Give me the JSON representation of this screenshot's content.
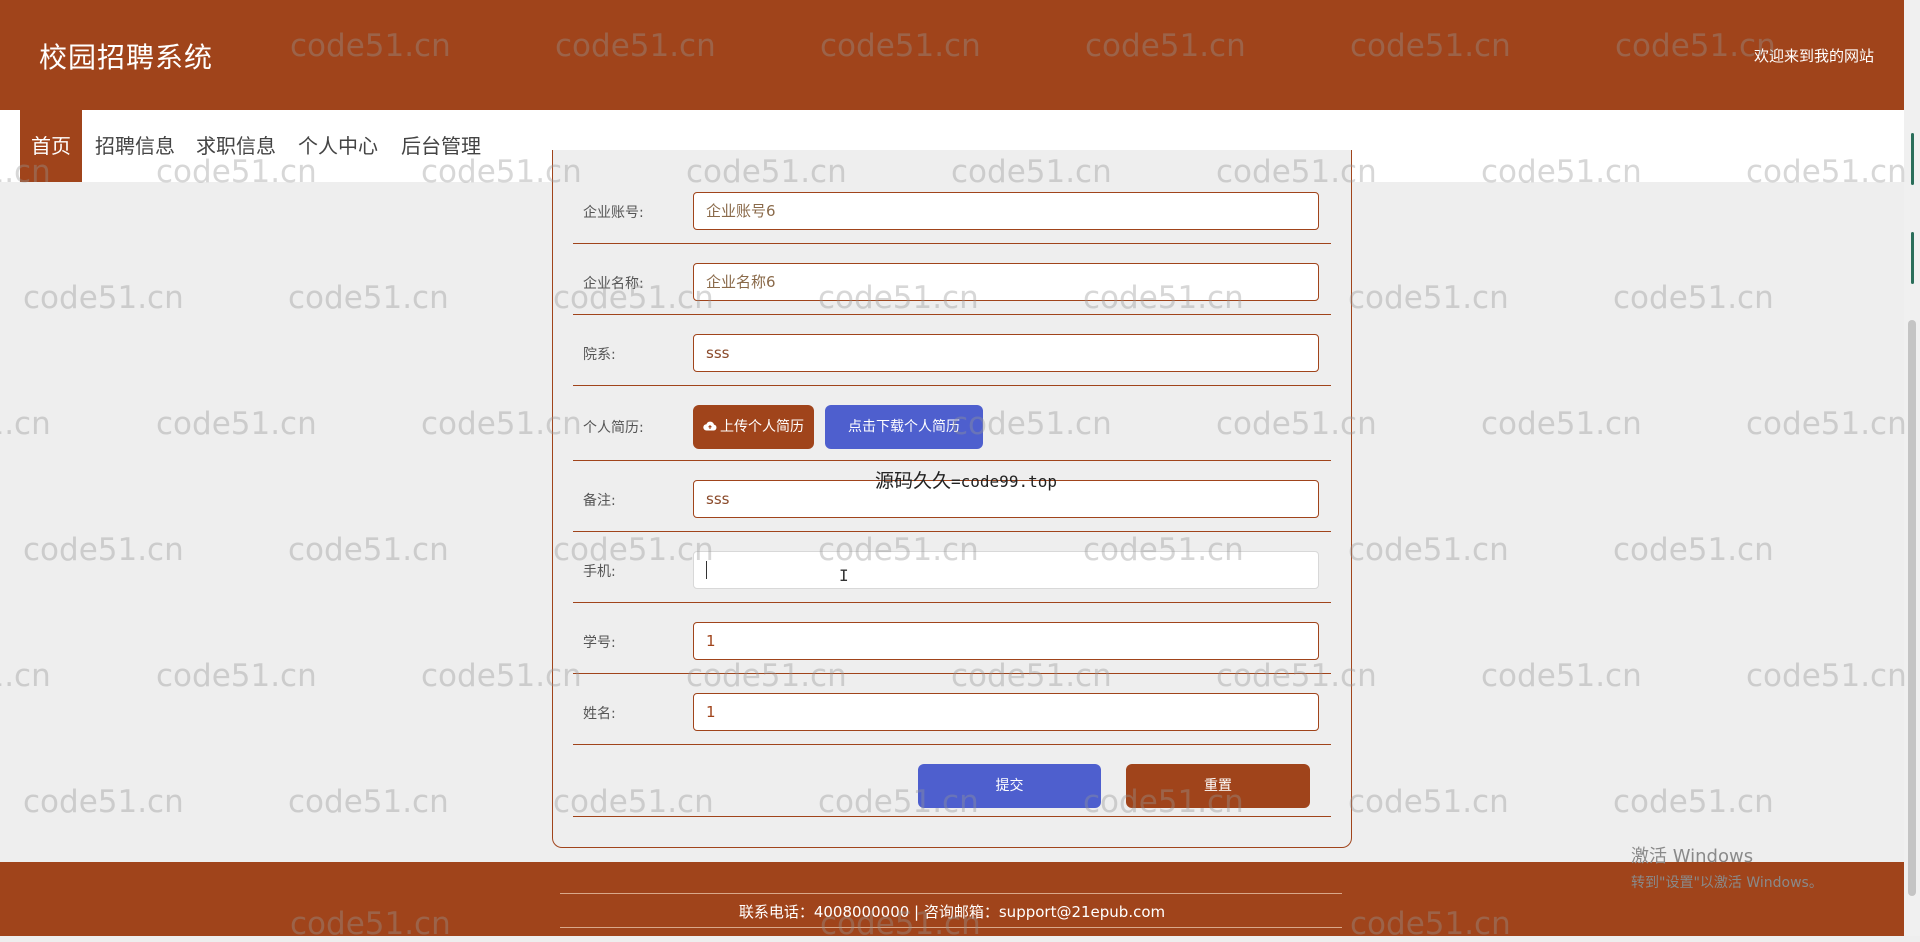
{
  "header": {
    "title": "校园招聘系统",
    "welcome": "欢迎来到我的网站"
  },
  "nav": {
    "items": [
      {
        "label": "首页",
        "active": true
      },
      {
        "label": "招聘信息",
        "active": false
      },
      {
        "label": "求职信息",
        "active": false
      },
      {
        "label": "个人中心",
        "active": false
      },
      {
        "label": "后台管理",
        "active": false
      }
    ]
  },
  "form": {
    "company_account": {
      "label": "企业账号:",
      "value": "企业账号6"
    },
    "company_name": {
      "label": "企业名称:",
      "value": "企业名称6"
    },
    "department": {
      "label": "院系:",
      "value": "sss"
    },
    "resume": {
      "label": "个人简历:",
      "upload_label": "上传个人简历",
      "download_label": "点击下载个人简历"
    },
    "remark": {
      "label": "备注:",
      "value": "sss"
    },
    "phone": {
      "label": "手机:",
      "value": ""
    },
    "student_id": {
      "label": "学号:",
      "value": "1"
    },
    "name": {
      "label": "姓名:",
      "value": "1"
    },
    "submit_label": "提交",
    "reset_label": "重置"
  },
  "overlay": {
    "cn": "源码久久",
    "code": "=code99.top"
  },
  "footer": {
    "contact": "联系电话：4008000000 | 咨询邮箱：support@21epub.com"
  },
  "windows_activation": {
    "line1": "激活 Windows",
    "line2": "转到\"设置\"以激活 Windows。"
  },
  "watermark": {
    "text": "code51.cn"
  },
  "colors": {
    "brand": "#a0441b",
    "accent_blue": "#4e5fce",
    "background": "#eeeeee"
  }
}
